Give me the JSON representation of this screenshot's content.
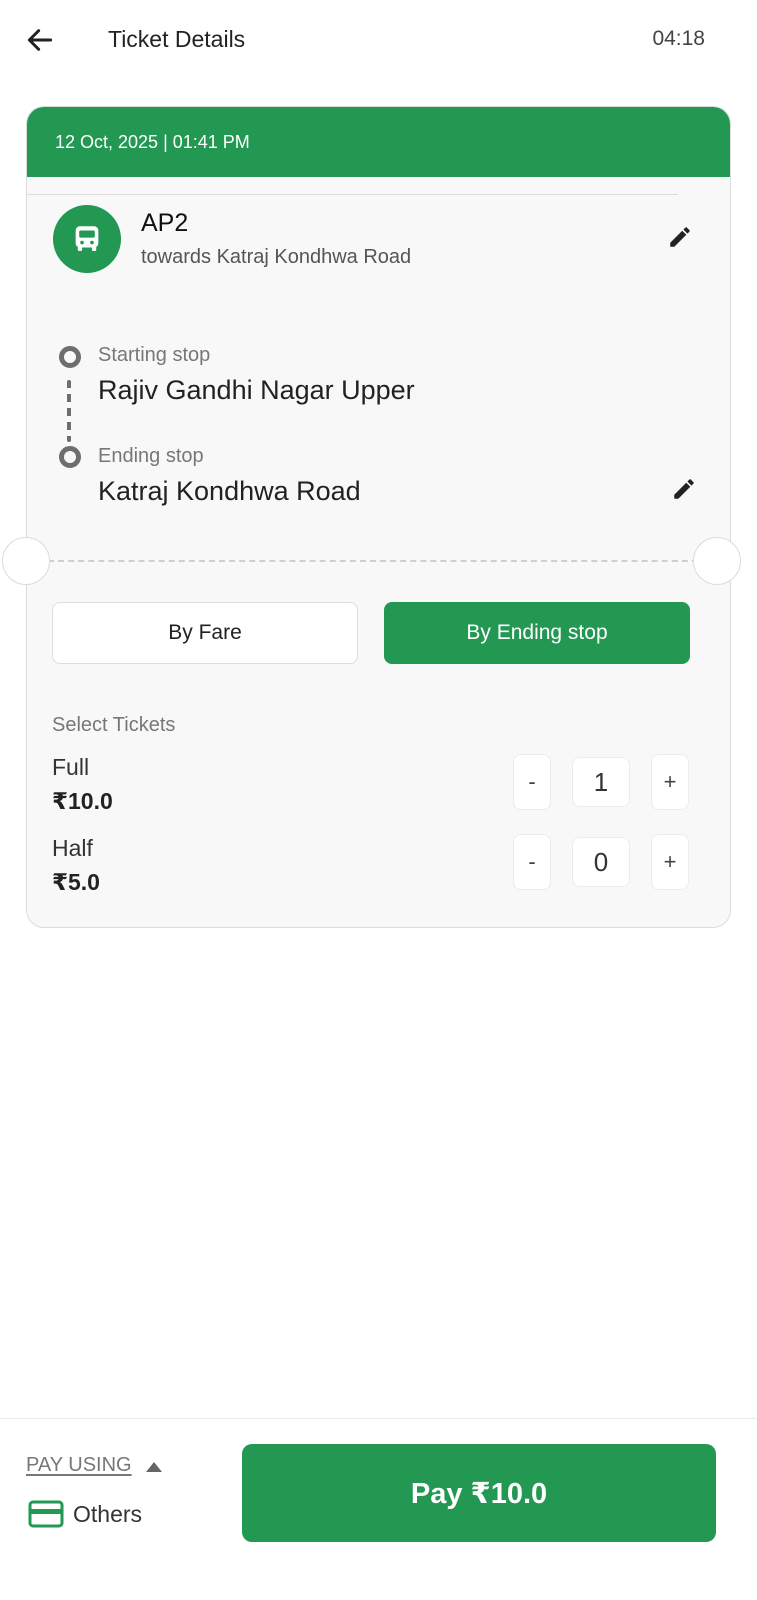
{
  "header": {
    "title": "Ticket Details",
    "timer": "04:18"
  },
  "ticket": {
    "datetime": "12 Oct, 2025 | 01:41 PM",
    "route_code": "AP2",
    "route_direction": "towards Katraj Kondhwa Road",
    "starting_stop_label": "Starting stop",
    "starting_stop_name": "Rajiv Gandhi Nagar Upper",
    "ending_stop_label": "Ending stop",
    "ending_stop_name": "Katraj Kondhwa Road"
  },
  "mode_toggle": {
    "options": [
      "By Fare",
      "By Ending stop"
    ],
    "selected": "By Ending stop"
  },
  "select_tickets": {
    "title": "Select Tickets",
    "types": [
      {
        "name": "Full",
        "price": "₹10.0",
        "quantity": "1",
        "minus": "-",
        "plus": "+"
      },
      {
        "name": "Half",
        "price": "₹5.0",
        "quantity": "0",
        "minus": "-",
        "plus": "+"
      }
    ]
  },
  "payment": {
    "pay_using_label": "PAY USING",
    "method": "Others",
    "pay_button": "Pay ₹10.0"
  },
  "colors": {
    "brand_green": "#229853",
    "card_bg": "#f8f8f8",
    "muted_text": "#777777"
  },
  "icons": {
    "back": "arrow-left-icon",
    "bus": "bus-icon",
    "edit": "pencil-icon",
    "stop": "circle-outline-icon",
    "payment_method": "credit-card-icon",
    "expand": "caret-up-icon"
  }
}
